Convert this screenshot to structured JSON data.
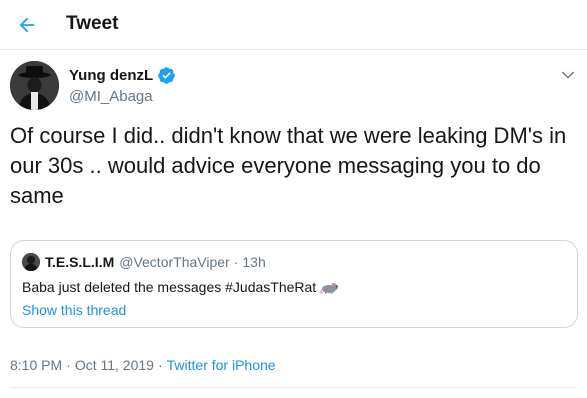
{
  "header": {
    "title": "Tweet"
  },
  "author": {
    "name": "Yung denzL",
    "handle": "@MI_Abaga"
  },
  "tweet": {
    "text": "Of course I did.. didn't know that we were leaking DM's in our 30s .. would advice everyone messaging you to do same"
  },
  "quoted": {
    "name": "T.E.S.L.I.M",
    "handle": "@VectorThaViper",
    "separator": "·",
    "time": "13h",
    "text": "Baba just deleted the messages #JudasTheRat",
    "show_thread": "Show this thread"
  },
  "meta": {
    "time": "8:10 PM",
    "separator": "·",
    "date": "Oct 11, 2019",
    "source": "Twitter for iPhone"
  },
  "colors": {
    "accent": "#1da1f2",
    "link": "#1b95e0",
    "muted": "#657786",
    "text": "#14171a",
    "border": "#ccd6dd"
  }
}
